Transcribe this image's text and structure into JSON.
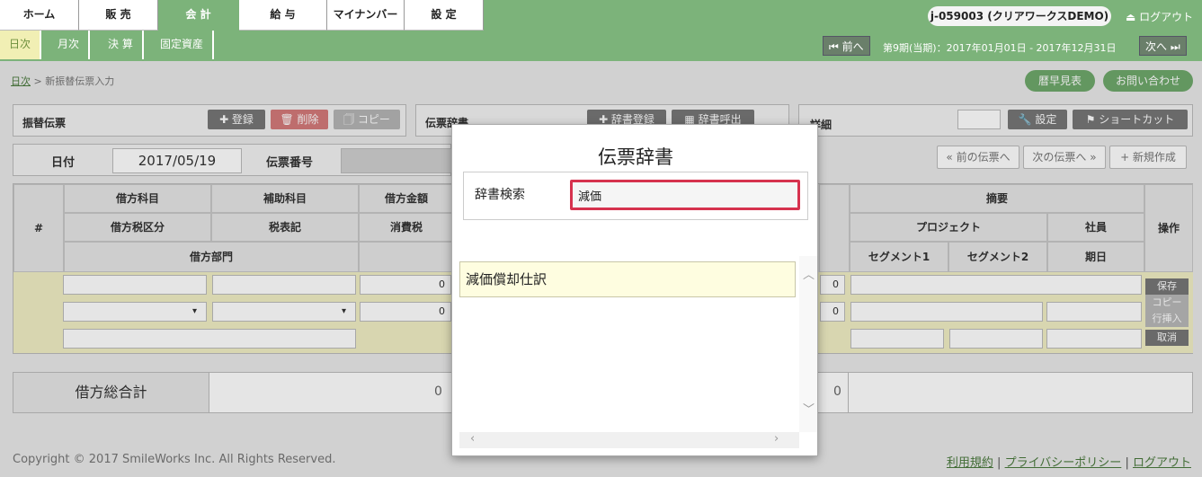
{
  "nav": {
    "tabs": [
      "ホーム",
      "販 売",
      "会 計",
      "給 与",
      "マイナンバー",
      "設 定"
    ],
    "user": "j-059003 (クリアワークスDEMO)",
    "logout_icon": "eject-icon",
    "logout": "ログアウト"
  },
  "subnav": {
    "tabs": [
      "日次",
      "月次",
      "決 算",
      "固定資産"
    ],
    "prev": "⏮ 前へ",
    "period": "第9期(当期)：2017年01月01日 - 2017年12月31日",
    "next": "次へ ⏭"
  },
  "breadcrumb": {
    "root": "日次",
    "sep": ">",
    "current": "新振替伝票入力"
  },
  "top_buttons": {
    "calendar": "暦早見表",
    "contact": "お問い合わせ"
  },
  "voucher_panel": {
    "title": "振替伝票",
    "register": "✚ 登録",
    "delete": "🗑 削除",
    "copy": "🗍 コピー"
  },
  "dict_panel": {
    "title": "伝票辞書",
    "register": "✚ 辞書登録",
    "call": "▦ 辞書呼出"
  },
  "detail_panel": {
    "title": "詳細",
    "settings": "🔧 設定",
    "shortcut": "⚑ ショートカット",
    "prev": "« 前の伝票へ",
    "next": "次の伝票へ »",
    "new": "+ 新規作成"
  },
  "form": {
    "date_label": "日付",
    "date_value": "2017/05/19",
    "number_label": "伝票番号"
  },
  "grid": {
    "hash": "#",
    "row1": [
      "借方科目",
      "補助科目",
      "借方金額"
    ],
    "row2": [
      "借方税区分",
      "税表記",
      "消費税"
    ],
    "row3": [
      "借方部門"
    ],
    "summary": "摘要",
    "project": "プロジェクト",
    "employee": "社員",
    "segment1": "セグメント1",
    "segment2": "セグメント2",
    "due": "期日",
    "ops": "操作",
    "zero": "0",
    "op_buttons": [
      "保存",
      "コピー",
      "行挿入",
      "取消"
    ]
  },
  "totals": {
    "label": "借方総合計",
    "debit": "0",
    "credit": "0"
  },
  "footer": {
    "copyright": "Copyright © 2017 SmileWorks Inc. All Rights Reserved.",
    "terms": "利用規約",
    "privacy": "プライバシーポリシー",
    "logout": "ログアウト",
    "sep": "|"
  },
  "modal": {
    "title": "伝票辞書",
    "search_label": "辞書検索",
    "search_value": "減価",
    "results": [
      "減価償却仕訳"
    ]
  }
}
